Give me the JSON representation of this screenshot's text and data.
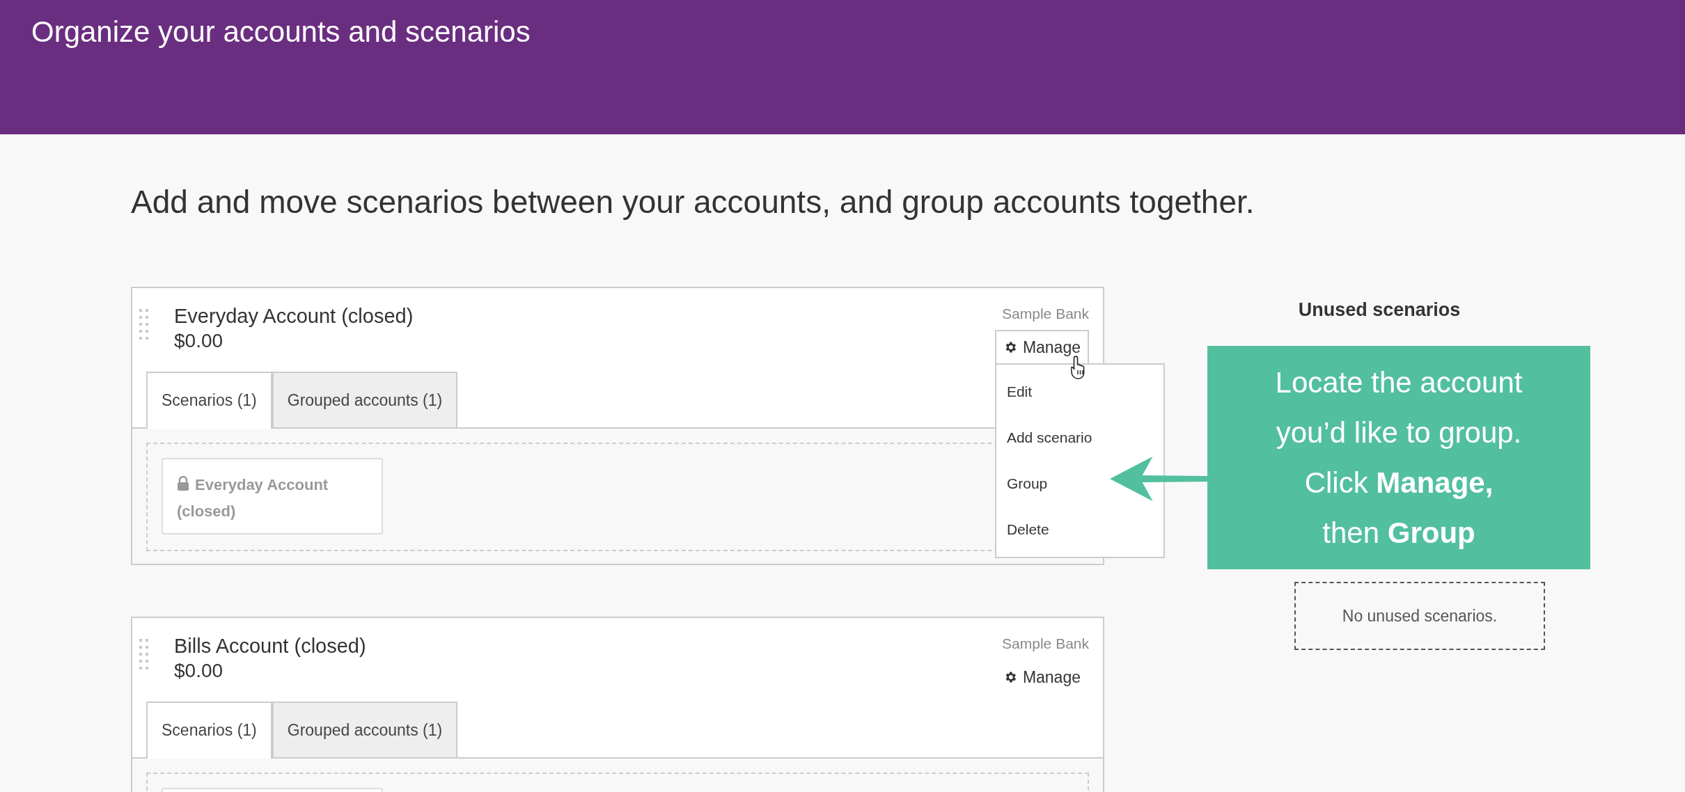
{
  "header": {
    "title": "Organize your accounts and scenarios"
  },
  "intro": "Add and move scenarios between your accounts, and group accounts together.",
  "accounts": [
    {
      "name": "Everyday Account (closed)",
      "balance": "$0.00",
      "bank": "Sample Bank",
      "manage": {
        "label": "Manage",
        "open": true,
        "menu": [
          "Edit",
          "Add scenario",
          "Group",
          "Delete"
        ]
      },
      "tabs": [
        {
          "label": "Scenarios (1)",
          "selected": true
        },
        {
          "label": "Grouped accounts (1)",
          "selected": false
        }
      ],
      "scenarios": [
        {
          "kind": "card",
          "name": "Everyday Account (closed)",
          "locked": true
        }
      ]
    },
    {
      "name": "Bills Account (closed)",
      "balance": "$0.00",
      "bank": "Sample Bank",
      "manage": {
        "label": "Manage",
        "open": false
      },
      "tabs": [
        {
          "label": "Scenarios (1)",
          "selected": true
        },
        {
          "label": "Grouped accounts (1)",
          "selected": false
        }
      ],
      "scenarios": [
        {
          "kind": "card"
        }
      ]
    }
  ],
  "unused": {
    "title": "Unused scenarios",
    "empty_text": "No unused scenarios."
  },
  "callout": {
    "lines": [
      "Locate the account",
      "you’d like to group.",
      "Click **Manage,**",
      "then **Group**"
    ]
  }
}
